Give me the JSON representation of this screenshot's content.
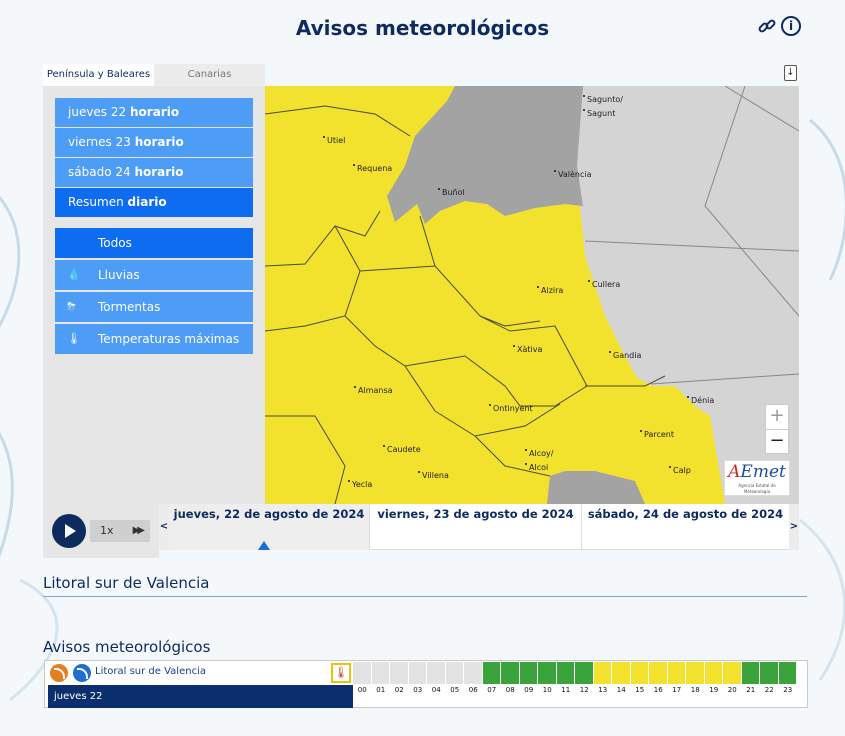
{
  "header": {
    "title": "Avisos meteorológicos",
    "link_icon": "link-icon",
    "info_icon": "info-icon"
  },
  "tabs": [
    {
      "label": "Península y Baleares",
      "active": true
    },
    {
      "label": "Canarias",
      "active": false
    }
  ],
  "periods": [
    {
      "day": "jueves 22",
      "mode": "horario"
    },
    {
      "day": "viernes 23",
      "mode": "horario"
    },
    {
      "day": "sábado 24",
      "mode": "horario"
    },
    {
      "day": "Resumen",
      "mode": "diario",
      "selected": true
    }
  ],
  "phenomena": [
    {
      "label": "Todos",
      "icon": "",
      "selected": true
    },
    {
      "label": "Lluvias",
      "icon": "rain-icon"
    },
    {
      "label": "Tormentas",
      "icon": "storm-icon"
    },
    {
      "label": "Temperaturas máximas",
      "icon": "thermometer-icon"
    }
  ],
  "map": {
    "cities": [
      "Sagunto/",
      "Sagunt",
      "Utiel",
      "Requena",
      "Buñol",
      "València",
      "Alzira",
      "Cullera",
      "Xàtiva",
      "Gandia",
      "Almansa",
      "Ontinyent",
      "Dénia",
      "Parcent",
      "Caudete",
      "Alcoy/",
      "Alcoi",
      "Villena",
      "Calp",
      "Yecla"
    ],
    "zoom_in": "+",
    "zoom_out": "−",
    "logo_a": "A",
    "logo_rest": "Emet",
    "logo_sub": "Agencia Estatal de Meteorología",
    "colors": {
      "yellow": "#f2e22d",
      "gray": "#a3a3a3",
      "sea": "#d4d4d4"
    }
  },
  "player": {
    "speed": "1x",
    "ff": "▶▶"
  },
  "timeline": {
    "prev": "<",
    "next": ">",
    "days": [
      {
        "label": "jueves, 22 de agosto de 2024",
        "active": true
      },
      {
        "label": "viernes, 23 de agosto de 2024",
        "active": false
      },
      {
        "label": "sábado, 24 de agosto de 2024",
        "active": false
      }
    ]
  },
  "zone_title": "Litoral sur de Valencia",
  "warnings": {
    "title": "Avisos meteorológicos",
    "zone_link": "Litoral sur de Valencia",
    "day_label": "jueves 22",
    "hours": [
      "00",
      "01",
      "02",
      "03",
      "04",
      "05",
      "06",
      "07",
      "08",
      "09",
      "10",
      "11",
      "12",
      "13",
      "14",
      "15",
      "16",
      "17",
      "18",
      "19",
      "20",
      "21",
      "22",
      "23"
    ],
    "levels": [
      "none",
      "none",
      "none",
      "none",
      "none",
      "none",
      "none",
      "green",
      "green",
      "green",
      "green",
      "green",
      "green",
      "yellow",
      "yellow",
      "yellow",
      "yellow",
      "yellow",
      "yellow",
      "yellow",
      "yellow",
      "green",
      "green",
      "green"
    ],
    "level_colors": {
      "none": "#e3e3e3",
      "green": "#3aa33a",
      "yellow": "#f2e22d"
    }
  }
}
